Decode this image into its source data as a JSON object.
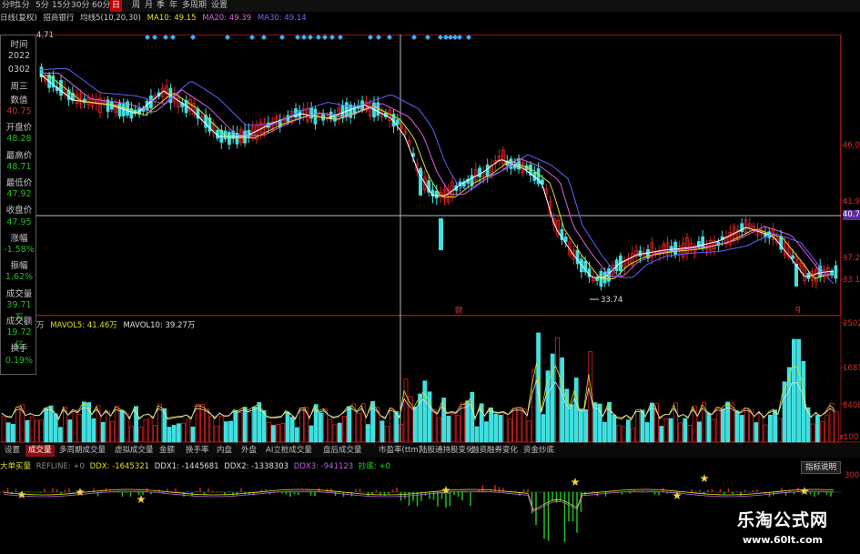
{
  "toolbar": {
    "items": [
      "分时",
      "1分",
      "5分",
      "15分",
      "30分",
      "60分",
      "日",
      "周",
      "月",
      "季",
      "年",
      "多周期",
      "设置"
    ],
    "active": "日"
  },
  "info": {
    "mode": "日线(复权)",
    "stock": "招商银行",
    "ma_name": "均线5(10,20,30)",
    "ma10": "MA10: 49.15",
    "ma20": "MA20: 49.39",
    "ma30": "MA30: 49.14"
  },
  "sidebar": [
    {
      "text": "时间",
      "color": "#c8c8c8"
    },
    {
      "text": "2022",
      "color": "#c8c8c8"
    },
    {
      "text": "0302",
      "color": "#c8c8c8"
    },
    {
      "text": "周三",
      "color": "#c8c8c8"
    },
    {
      "text": "数值",
      "color": "#c8c8c8"
    },
    {
      "text": "40.75",
      "color": "#d03030"
    },
    {
      "text": "开盘价",
      "color": "#c8c8c8"
    },
    {
      "text": "48.28",
      "color": "#20c020"
    },
    {
      "text": "最高价",
      "color": "#c8c8c8"
    },
    {
      "text": "48.71",
      "color": "#20c020"
    },
    {
      "text": "最低价",
      "color": "#c8c8c8"
    },
    {
      "text": "47.92",
      "color": "#20c020"
    },
    {
      "text": "收盘价",
      "color": "#c8c8c8"
    },
    {
      "text": "47.95",
      "color": "#20c020"
    },
    {
      "text": "涨幅",
      "color": "#c8c8c8"
    },
    {
      "text": "-1.58%",
      "color": "#20c020"
    },
    {
      "text": "振幅",
      "color": "#c8c8c8"
    },
    {
      "text": "1.62%",
      "color": "#20c020"
    },
    {
      "text": "成交量",
      "color": "#c8c8c8"
    },
    {
      "text": "39.71万",
      "color": "#20c020"
    },
    {
      "text": "成交额",
      "color": "#c8c8c8"
    },
    {
      "text": "19.72亿",
      "color": "#20c020"
    },
    {
      "text": "换手",
      "color": "#c8c8c8"
    },
    {
      "text": "0.19%",
      "color": "#20c020"
    }
  ],
  "price_axis": {
    "labels": [
      "46.0",
      "41.9",
      "40.75",
      "37.2",
      "33.1"
    ],
    "top_label": "4.71",
    "crosshair_value": "40.75",
    "low_label": "33.74",
    "marker_a": "财",
    "marker_b": "q"
  },
  "volume": {
    "unit": "万",
    "mavol5": "MAVOL5: 41.46万",
    "mavol10": "MAVOL10: 39.27万",
    "axis": [
      "2502",
      "1681",
      "8408",
      "x100"
    ]
  },
  "tabs": {
    "items": [
      "设置",
      "成交量",
      "多周期成交量",
      "虚拟成交量",
      "金额",
      "换手率",
      "内盘",
      "外盘",
      "AI立桩成交量",
      "盘后成交量",
      "市盈率(ttm)",
      "陆股通持股变化",
      "融资融券变化",
      "资金炒底"
    ],
    "active": "成交量"
  },
  "ddx": {
    "name": "大单买量",
    "refline": "REFLINE: +0",
    "ddx": "DDX: -1645321",
    "ddx1": "DDX1: -1445681",
    "ddx2": "DDX2: -1338303",
    "ddx3": "DDX3: -941123",
    "jc": "抄底: +0",
    "button": "指标说明",
    "axis": "300"
  },
  "watermark": {
    "line1": "乐淘公式网",
    "line2": "www.60lt.com"
  },
  "colors": {
    "up": "#e02020",
    "down": "#40e0e0",
    "ma5": "#ffffff",
    "ma10": "#e0e020",
    "ma20": "#e060e0",
    "ma30": "#6060ff",
    "border": "#8a1818"
  }
}
